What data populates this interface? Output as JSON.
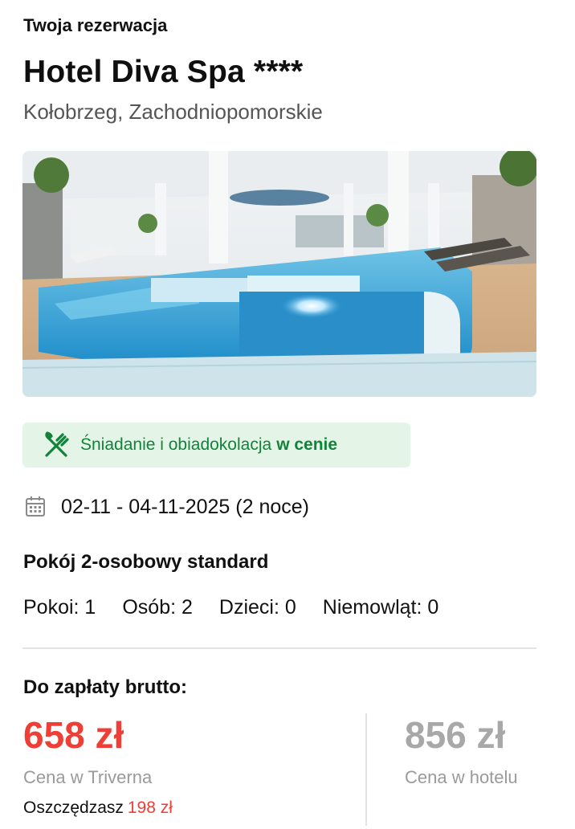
{
  "header": {
    "eyebrow": "Twoja rezerwacja",
    "hotel_name": "Hotel Diva Spa ****",
    "location": "Kołobrzeg, Zachodniopomorskie"
  },
  "photo": {
    "icon": "hotel-pool-photo"
  },
  "meal": {
    "icon": "fork-knife-icon",
    "text": "Śniadanie i obiadokolacja",
    "highlight": "w cenie",
    "color": "#12833a",
    "background": "#e4f5e8"
  },
  "stay": {
    "icon": "calendar-icon",
    "dates": "02-11 - 04-11-2025 (2 noce)"
  },
  "room": {
    "type": "Pokój 2-osobowy standard",
    "counts": [
      "Pokoi: 1",
      "Osób: 2",
      "Dzieci: 0",
      "Niemowląt: 0"
    ]
  },
  "payment": {
    "label": "Do zapłaty brutto:",
    "our_price": "658 zł",
    "our_caption": "Cena w Triverna",
    "hotel_price": "856 zł",
    "hotel_caption": "Cena w hotelu",
    "savings_label": "Oszczędzasz",
    "savings_amount": "198 zł",
    "accent_color": "#ef3e36"
  }
}
